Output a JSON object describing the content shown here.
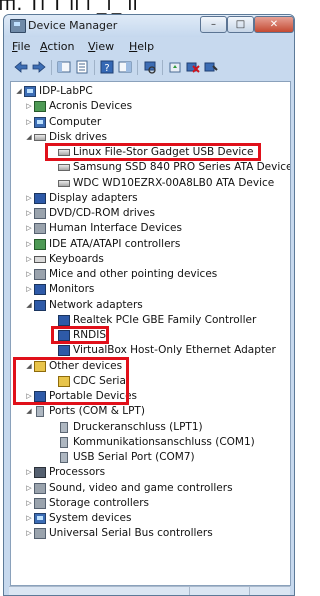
{
  "window": {
    "title": "Device Manager",
    "controls": {
      "minimize": "–",
      "maximize": "□",
      "close": "✕"
    }
  },
  "menu": [
    {
      "hotkey": "F",
      "rest": "ile"
    },
    {
      "hotkey": "A",
      "rest": "ction"
    },
    {
      "hotkey": "V",
      "rest": "iew"
    },
    {
      "hotkey": "H",
      "rest": "elp"
    }
  ],
  "toolbar": {
    "buttons": [
      "back-arrow",
      "forward-arrow",
      "show-hide-console-tree",
      "properties",
      "help",
      "action-pane",
      "scan-hardware",
      "update-driver",
      "uninstall",
      "disable"
    ]
  },
  "header_strip_text": "ffi.      Tl  T   ll       l   _l_       ll",
  "tree": [
    {
      "label": "IDP-LabPC",
      "level": 0,
      "expander": "open",
      "icon": "computer"
    },
    {
      "label": "Acronis Devices",
      "level": 1,
      "expander": "closed",
      "icon": "green"
    },
    {
      "label": "Computer",
      "level": 1,
      "expander": "closed",
      "icon": "computer"
    },
    {
      "label": "Disk drives",
      "level": 1,
      "expander": "open",
      "icon": "drive"
    },
    {
      "label": "Linux File-Stor Gadget USB Device",
      "level": 2,
      "expander": "",
      "icon": "drive"
    },
    {
      "label": "Samsung SSD 840 PRO Series ATA Device",
      "level": 2,
      "expander": "",
      "icon": "drive"
    },
    {
      "label": "WDC WD10EZRX-00A8LB0 ATA Device",
      "level": 2,
      "expander": "",
      "icon": "drive"
    },
    {
      "label": "Display adapters",
      "level": 1,
      "expander": "closed",
      "icon": "monitor"
    },
    {
      "label": "DVD/CD-ROM drives",
      "level": 1,
      "expander": "closed",
      "icon": "gray"
    },
    {
      "label": "Human Interface Devices",
      "level": 1,
      "expander": "closed",
      "icon": "gray"
    },
    {
      "label": "IDE ATA/ATAPI controllers",
      "level": 1,
      "expander": "closed",
      "icon": "green"
    },
    {
      "label": "Keyboards",
      "level": 1,
      "expander": "closed",
      "icon": "kbd"
    },
    {
      "label": "Mice and other pointing devices",
      "level": 1,
      "expander": "closed",
      "icon": "gray"
    },
    {
      "label": "Monitors",
      "level": 1,
      "expander": "closed",
      "icon": "monitor"
    },
    {
      "label": "Network adapters",
      "level": 1,
      "expander": "open",
      "icon": "monitor"
    },
    {
      "label": "Realtek PCIe GBE Family Controller",
      "level": 2,
      "expander": "",
      "icon": "monitor"
    },
    {
      "label": "RNDIS",
      "level": 2,
      "expander": "",
      "icon": "monitor"
    },
    {
      "label": "VirtualBox Host-Only Ethernet Adapter",
      "level": 2,
      "expander": "",
      "icon": "monitor"
    },
    {
      "label": "Other devices",
      "level": 1,
      "expander": "open",
      "icon": "yellow"
    },
    {
      "label": "CDC Serial",
      "level": 2,
      "expander": "",
      "icon": "yellow"
    },
    {
      "label": "Portable Devices",
      "level": 1,
      "expander": "closed",
      "icon": "monitor"
    },
    {
      "label": "Ports (COM & LPT)",
      "level": 1,
      "expander": "open",
      "icon": "port"
    },
    {
      "label": "Druckeranschluss (LPT1)",
      "level": 2,
      "expander": "",
      "icon": "port"
    },
    {
      "label": "Kommunikationsanschluss (COM1)",
      "level": 2,
      "expander": "",
      "icon": "port"
    },
    {
      "label": "USB Serial Port (COM7)",
      "level": 2,
      "expander": "",
      "icon": "port"
    },
    {
      "label": "Processors",
      "level": 1,
      "expander": "closed",
      "icon": "chip"
    },
    {
      "label": "Sound, video and game controllers",
      "level": 1,
      "expander": "closed",
      "icon": "gray"
    },
    {
      "label": "Storage controllers",
      "level": 1,
      "expander": "closed",
      "icon": "gray"
    },
    {
      "label": "System devices",
      "level": 1,
      "expander": "closed",
      "icon": "computer"
    },
    {
      "label": "Universal Serial Bus controllers",
      "level": 1,
      "expander": "closed",
      "icon": "gray"
    }
  ],
  "highlight_color": "#e0101a"
}
